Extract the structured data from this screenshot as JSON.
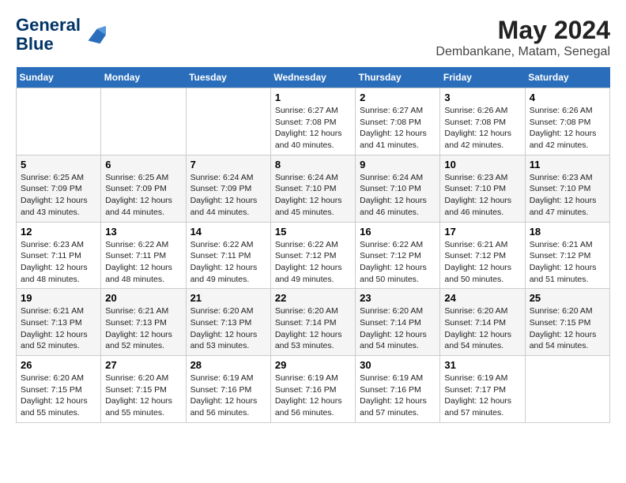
{
  "header": {
    "logo_line1": "General",
    "logo_line2": "Blue",
    "main_title": "May 2024",
    "subtitle": "Dembankane, Matam, Senegal"
  },
  "days_of_week": [
    "Sunday",
    "Monday",
    "Tuesday",
    "Wednesday",
    "Thursday",
    "Friday",
    "Saturday"
  ],
  "weeks": [
    [
      {
        "day": "",
        "info": ""
      },
      {
        "day": "",
        "info": ""
      },
      {
        "day": "",
        "info": ""
      },
      {
        "day": "1",
        "info": "Sunrise: 6:27 AM\nSunset: 7:08 PM\nDaylight: 12 hours\nand 40 minutes."
      },
      {
        "day": "2",
        "info": "Sunrise: 6:27 AM\nSunset: 7:08 PM\nDaylight: 12 hours\nand 41 minutes."
      },
      {
        "day": "3",
        "info": "Sunrise: 6:26 AM\nSunset: 7:08 PM\nDaylight: 12 hours\nand 42 minutes."
      },
      {
        "day": "4",
        "info": "Sunrise: 6:26 AM\nSunset: 7:08 PM\nDaylight: 12 hours\nand 42 minutes."
      }
    ],
    [
      {
        "day": "5",
        "info": "Sunrise: 6:25 AM\nSunset: 7:09 PM\nDaylight: 12 hours\nand 43 minutes."
      },
      {
        "day": "6",
        "info": "Sunrise: 6:25 AM\nSunset: 7:09 PM\nDaylight: 12 hours\nand 44 minutes."
      },
      {
        "day": "7",
        "info": "Sunrise: 6:24 AM\nSunset: 7:09 PM\nDaylight: 12 hours\nand 44 minutes."
      },
      {
        "day": "8",
        "info": "Sunrise: 6:24 AM\nSunset: 7:10 PM\nDaylight: 12 hours\nand 45 minutes."
      },
      {
        "day": "9",
        "info": "Sunrise: 6:24 AM\nSunset: 7:10 PM\nDaylight: 12 hours\nand 46 minutes."
      },
      {
        "day": "10",
        "info": "Sunrise: 6:23 AM\nSunset: 7:10 PM\nDaylight: 12 hours\nand 46 minutes."
      },
      {
        "day": "11",
        "info": "Sunrise: 6:23 AM\nSunset: 7:10 PM\nDaylight: 12 hours\nand 47 minutes."
      }
    ],
    [
      {
        "day": "12",
        "info": "Sunrise: 6:23 AM\nSunset: 7:11 PM\nDaylight: 12 hours\nand 48 minutes."
      },
      {
        "day": "13",
        "info": "Sunrise: 6:22 AM\nSunset: 7:11 PM\nDaylight: 12 hours\nand 48 minutes."
      },
      {
        "day": "14",
        "info": "Sunrise: 6:22 AM\nSunset: 7:11 PM\nDaylight: 12 hours\nand 49 minutes."
      },
      {
        "day": "15",
        "info": "Sunrise: 6:22 AM\nSunset: 7:12 PM\nDaylight: 12 hours\nand 49 minutes."
      },
      {
        "day": "16",
        "info": "Sunrise: 6:22 AM\nSunset: 7:12 PM\nDaylight: 12 hours\nand 50 minutes."
      },
      {
        "day": "17",
        "info": "Sunrise: 6:21 AM\nSunset: 7:12 PM\nDaylight: 12 hours\nand 50 minutes."
      },
      {
        "day": "18",
        "info": "Sunrise: 6:21 AM\nSunset: 7:12 PM\nDaylight: 12 hours\nand 51 minutes."
      }
    ],
    [
      {
        "day": "19",
        "info": "Sunrise: 6:21 AM\nSunset: 7:13 PM\nDaylight: 12 hours\nand 52 minutes."
      },
      {
        "day": "20",
        "info": "Sunrise: 6:21 AM\nSunset: 7:13 PM\nDaylight: 12 hours\nand 52 minutes."
      },
      {
        "day": "21",
        "info": "Sunrise: 6:20 AM\nSunset: 7:13 PM\nDaylight: 12 hours\nand 53 minutes."
      },
      {
        "day": "22",
        "info": "Sunrise: 6:20 AM\nSunset: 7:14 PM\nDaylight: 12 hours\nand 53 minutes."
      },
      {
        "day": "23",
        "info": "Sunrise: 6:20 AM\nSunset: 7:14 PM\nDaylight: 12 hours\nand 54 minutes."
      },
      {
        "day": "24",
        "info": "Sunrise: 6:20 AM\nSunset: 7:14 PM\nDaylight: 12 hours\nand 54 minutes."
      },
      {
        "day": "25",
        "info": "Sunrise: 6:20 AM\nSunset: 7:15 PM\nDaylight: 12 hours\nand 54 minutes."
      }
    ],
    [
      {
        "day": "26",
        "info": "Sunrise: 6:20 AM\nSunset: 7:15 PM\nDaylight: 12 hours\nand 55 minutes."
      },
      {
        "day": "27",
        "info": "Sunrise: 6:20 AM\nSunset: 7:15 PM\nDaylight: 12 hours\nand 55 minutes."
      },
      {
        "day": "28",
        "info": "Sunrise: 6:19 AM\nSunset: 7:16 PM\nDaylight: 12 hours\nand 56 minutes."
      },
      {
        "day": "29",
        "info": "Sunrise: 6:19 AM\nSunset: 7:16 PM\nDaylight: 12 hours\nand 56 minutes."
      },
      {
        "day": "30",
        "info": "Sunrise: 6:19 AM\nSunset: 7:16 PM\nDaylight: 12 hours\nand 57 minutes."
      },
      {
        "day": "31",
        "info": "Sunrise: 6:19 AM\nSunset: 7:17 PM\nDaylight: 12 hours\nand 57 minutes."
      },
      {
        "day": "",
        "info": ""
      }
    ]
  ]
}
